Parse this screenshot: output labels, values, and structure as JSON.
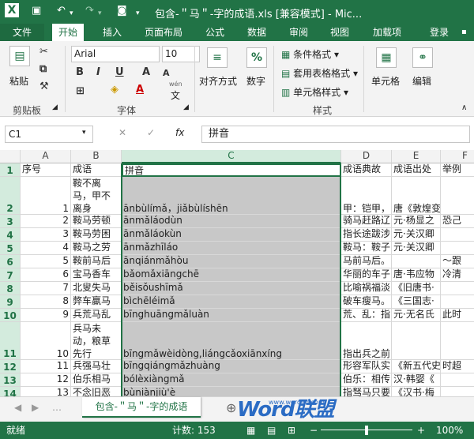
{
  "window": {
    "title": "包含-＂马＂-字的成语.xls  [兼容模式] - Mic..."
  },
  "ribbon_tabs": [
    "文件",
    "开始",
    "插入",
    "页面布局",
    "公式",
    "数据",
    "审阅",
    "视图",
    "加载项",
    "登录"
  ],
  "ribbon": {
    "clipboard_group": "剪贴板",
    "paste_label": "粘贴",
    "font_group": "字体",
    "font_name": "Arial",
    "font_size": "10",
    "bold": "B",
    "italic": "I",
    "underline": "U",
    "align_label": "对齐方式",
    "number_label": "数字",
    "cond_format": "条件格式",
    "table_format": "套用表格格式",
    "cell_style": "单元格样式",
    "style_group": "样式",
    "cells_label": "单元格",
    "edit_label": "编辑",
    "percent": "%",
    "wen": "wén",
    "wen_char": "文"
  },
  "formula_bar": {
    "name_box": "C1",
    "fx": "fx",
    "content": "拼音"
  },
  "columns": [
    "A",
    "B",
    "C",
    "D",
    "E",
    "F"
  ],
  "rows": [
    {
      "n": "1",
      "a": "序号",
      "b": "成语",
      "c": "拼音",
      "d": "成语典故",
      "e": "成语出处",
      "f": "举例"
    },
    {
      "n": "2",
      "a": "1",
      "b": "鞍不离马，甲不离身",
      "b1": "鞍不离",
      "b2": "马，甲不",
      "b3": "离身",
      "c": "ānbùlímǎ，jiǎbùlíshēn",
      "d": "甲：铠甲，",
      "e": "唐《敦煌变",
      "f": ""
    },
    {
      "n": "3",
      "a": "2",
      "b": "鞍马劳顿",
      "c": "ānmǎláodùn",
      "d": "骑马赶路辽",
      "e": "元·杨显之",
      "f": "恐己"
    },
    {
      "n": "4",
      "a": "3",
      "b": "鞍马劳困",
      "c": "ānmǎláokùn",
      "d": "指长途跋涉",
      "e": "元·关汉卿",
      "f": ""
    },
    {
      "n": "5",
      "a": "4",
      "b": "鞍马之劳",
      "c": "ānmǎzhīláo",
      "d": "鞍马：鞍子",
      "e": "元·关汉卿",
      "f": ""
    },
    {
      "n": "6",
      "a": "5",
      "b": "鞍前马后",
      "c": "ānqiánmǎhòu",
      "d": "马前马后。",
      "e": "",
      "f": "～跟"
    },
    {
      "n": "7",
      "a": "6",
      "b": "宝马香车",
      "c": "bǎomǎxiāngchē",
      "d": "华丽的车子",
      "e": "唐·韦应物",
      "f": "冷清"
    },
    {
      "n": "8",
      "a": "7",
      "b": "北叟失马",
      "c": "běisǒushīmǎ",
      "d": "比喻祸福淡",
      "e": "《旧唐书·",
      "f": ""
    },
    {
      "n": "9",
      "a": "8",
      "b": "弊车羸马",
      "c": "bìchēléimǎ",
      "d": "破车瘦马。",
      "e": "《三国志·",
      "f": ""
    },
    {
      "n": "10",
      "a": "9",
      "b": "兵荒马乱",
      "c": "bīnghuāngmǎluàn",
      "d": "荒、乱：指",
      "e": "元·无名氏",
      "f": "此时"
    },
    {
      "n": "11",
      "a": "10",
      "b": "兵马未动，粮草先行",
      "b1": "兵马未",
      "b2": "动，粮草",
      "b3": "先行",
      "c": "bīngmǎwèidòng,liángcǎoxiānxíng",
      "d": "指出兵之前",
      "e": "",
      "f": ""
    },
    {
      "n": "12",
      "a": "11",
      "b": "兵强马壮",
      "c": "bīngqiángmǎzhuàng",
      "d": "形容军队实",
      "e": "《新五代史",
      "f": "时超"
    },
    {
      "n": "13",
      "a": "12",
      "b": "伯乐相马",
      "c": "bólèxiàngmǎ",
      "d": "伯乐：相传",
      "e": "汉·韩婴《",
      "f": ""
    },
    {
      "n": "14",
      "a": "13",
      "b": "不念旧恶",
      "c": "bùniànjiù'è",
      "d": "指驽马只要",
      "e": "《汉书·梅",
      "f": ""
    }
  ],
  "sheet_tab": "包含-＂马＂-字的成语",
  "status": {
    "ready": "就绪",
    "count": "计数: 153",
    "zoom": "100%"
  },
  "watermark": {
    "word": "Word联盟",
    "site": "www.wordlm.com"
  }
}
